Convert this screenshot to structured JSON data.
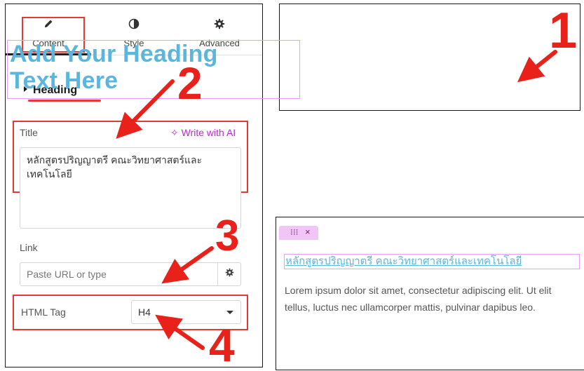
{
  "tabs": [
    {
      "label": "Content",
      "icon": "pencil-icon"
    },
    {
      "label": "Style",
      "icon": "half-circle-icon"
    },
    {
      "label": "Advanced",
      "icon": "gear-icon"
    }
  ],
  "section": {
    "title": "Heading"
  },
  "title_field": {
    "label": "Title",
    "ai_label": "Write with AI",
    "ai_icon": "sparkle-icon",
    "value_line1": "หลักสูตรปริญญาตรี คณะวิทยาศาสตร์และ",
    "value_line2": "เทคโนโลยี"
  },
  "link_field": {
    "label": "Link",
    "placeholder": "Paste URL or type",
    "icon": "gear-icon"
  },
  "html_tag": {
    "label": "HTML Tag",
    "value": "H4"
  },
  "preview_top": {
    "line1": "Add Your Heading",
    "line2": "Text Here"
  },
  "preview_bottom": {
    "handle_grip": "⁝⁝⁝",
    "handle_close": "×",
    "heading": "หลักสูตรปริญญาตรี คณะวิทยาศาสตร์และเทคโนโลยี",
    "paragraph": "Lorem ipsum dolor sit amet, consectetur adipiscing elit. Ut elit tellus, luctus nec ullamcorper mattis, pulvinar dapibus leo."
  },
  "annotations": {
    "n1": "1",
    "n2": "2",
    "n3": "3",
    "n4": "4"
  },
  "colors": {
    "annotation": "#e8211b",
    "heading": "#5bb6dd",
    "ai_accent": "#c026d3",
    "selection": "#e6a2f2"
  }
}
